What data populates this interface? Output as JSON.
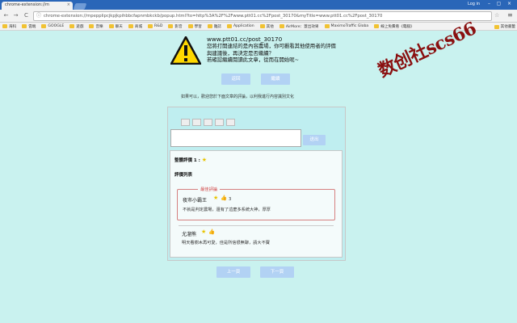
{
  "browser": {
    "tab_title": "chrome-extension://m",
    "tab_close": "×",
    "user": "Log in",
    "min": "–",
    "max": "▢",
    "close": "×",
    "back": "←",
    "forward": "→",
    "reload": "C",
    "url": "chrome-extension://mpepplipcjkpjkpihbbcfapnmbkckb/popup.html?to=http%3A%2F%2Fwww.ptt01.cc%2Fpost_30170&myTitle=www.ptt01.cc%2Fpost_30170",
    "star": "☆",
    "menu": "≡"
  },
  "bookmarks": [
    "海科",
    "雲端",
    "GOOGLE",
    "遊戲",
    "音樂",
    "聊天",
    "商城",
    "R&D",
    "影音",
    "學習",
    "雜誌",
    "Application",
    "其他",
    "AirMore：蓋出效果",
    "MaximoTraffic Globa",
    "線上免費看《電腦》"
  ],
  "bookmarks_other": "其他書籤",
  "blocked": {
    "url": "www.ptt01.cc/post_30170",
    "line1": "您將打開連結的是內容農場，你可觀看其他使用者的評價",
    "line2": "與建議後，再決定是否繼續？",
    "line3": "若確認繼續閱讀此文章，從而在開始呢~",
    "back_label": "返回",
    "continue_label": "繼續"
  },
  "note": "如果可以，歡迎您於下面文章的評論，以利我進行內容識別文化",
  "comment": {
    "placeholder": "",
    "send_label": "送出"
  },
  "reviews": {
    "avg_label": "整體評價 1 :",
    "list_label": "評價列表",
    "hot_label": "最佳評論",
    "items": [
      {
        "name": "夜市小霸王",
        "count": "3",
        "text": "不就是判定農場，還有了這麼多系統大神，厚厚"
      },
      {
        "name": "尤溜熊",
        "count": "",
        "text": "明天看樹木再可愛，佳是所信很無聊，請大不寶"
      }
    ]
  },
  "pager": {
    "prev_label": "上一頁",
    "next_label": "下一頁"
  },
  "watermark": "数创社scs66"
}
